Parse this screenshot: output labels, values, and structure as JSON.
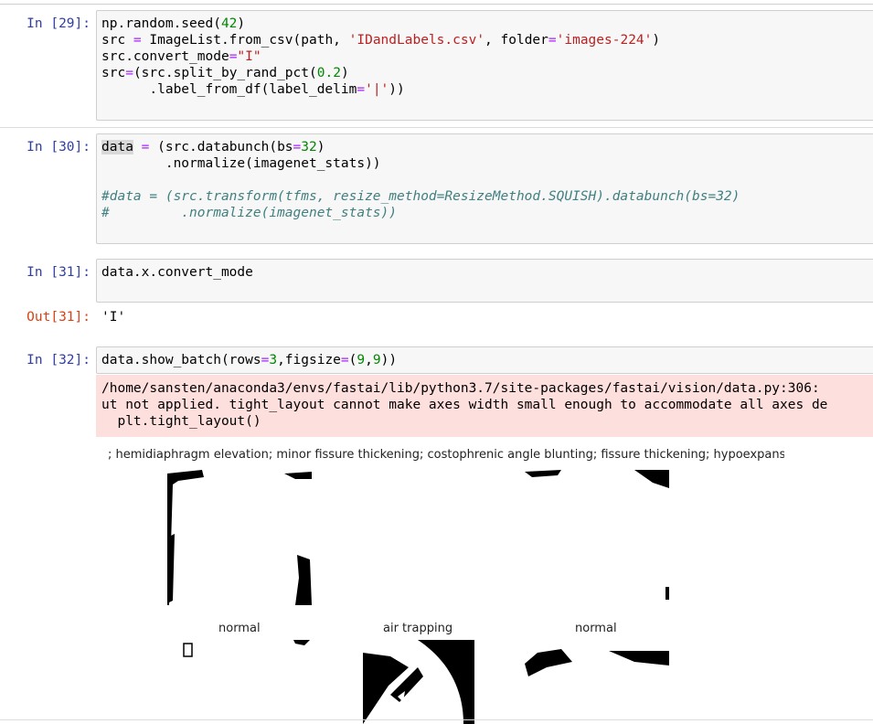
{
  "cells": [
    {
      "prompt": "In [29]:",
      "lines": [
        "np.random.seed(42)",
        "src = ImageList.from_csv(path, 'IDandLabels.csv', folder='images-224')",
        "src.convert_mode=\"I\"",
        "src=(src.split_by_rand_pct(0.2)",
        "      .label_from_df(label_delim='|'))"
      ]
    },
    {
      "prompt": "In [30]:",
      "lines": [
        "data = (src.databunch(bs=32)",
        "        .normalize(imagenet_stats))",
        "",
        "#data = (src.transform(tfms, resize_method=ResizeMethod.SQUISH).databunch(bs=32)",
        "#         .normalize(imagenet_stats))"
      ]
    },
    {
      "prompt": "In [31]:",
      "lines": [
        "data.x.convert_mode"
      ],
      "out_prompt": "Out[31]:",
      "output": "'I'"
    },
    {
      "prompt": "In [32]:",
      "lines": [
        "data.show_batch(rows=3,figsize=(9,9))"
      ],
      "stderr": "/home/sansten/anaconda3/envs/fastai/lib/python3.7/site-packages/fastai/vision/data.py:306: \nut not applied. tight_layout cannot make axes width small enough to accommodate all axes de\n  plt.tight_layout()",
      "figure": {
        "top_title": ";  hemidiaphragm elevation;  minor fissure thickening;  costophrenic angle blunting;  fissure thickening;  hypoexpansion;  vascular hilar enlargement;  aortic elongation;  scoliosis",
        "labels": [
          "normal",
          "air trapping",
          "normal"
        ]
      }
    }
  ]
}
